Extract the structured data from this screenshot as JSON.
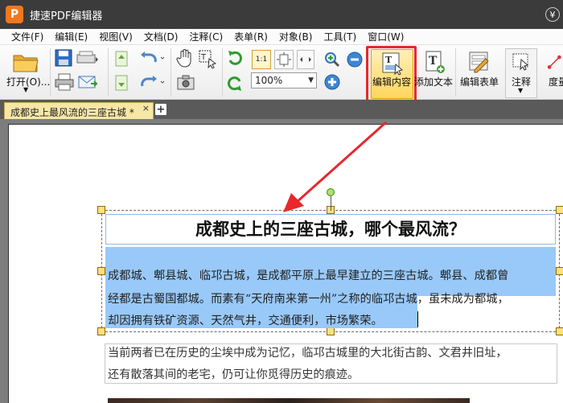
{
  "app": {
    "logo": "P",
    "title": "捷速PDF编辑器",
    "yen": "¥"
  },
  "menu": [
    "文件(F)",
    "编辑(E)",
    "视图(V)",
    "文档(D)",
    "注释(C)",
    "表单(R)",
    "对象(B)",
    "工具(T)",
    "窗口(W)"
  ],
  "toolbar": {
    "open_label": "打开(O)...",
    "zoom_value": "100%",
    "actual_size_label": "1:1",
    "edit_content_label": "编辑内容",
    "add_text_label": "添加文本",
    "edit_form_label": "编辑表单",
    "annotate_label": "注释",
    "degree_label": "度量"
  },
  "tabs": [
    {
      "label": "成都史上最风流的三座古城 *",
      "close": "×"
    }
  ],
  "tab_add": "+",
  "document": {
    "heading": "成都史上的三座古城，哪个最风流？",
    "para1_lines": [
      "成都城、郫县城、临邛古城，是成都平原上最早建立的三座古城。郫县、成都曾",
      "经都是古蜀国都城。而素有“天府南来第一州”之称的临邛古城，虽未成为都城，",
      "却因拥有铁矿资源、天然气井，交通便利，市场繁荣。"
    ],
    "para2_lines": [
      "当前两者已在历史的尘埃中成为记忆，临邛古城里的大北街古韵、文君井旧址，",
      "还有散落其间的老宅，仍可让你觅得历史的痕迹。"
    ]
  },
  "colors": {
    "titlebar": "#3b3b3b",
    "highlight": "#e8282b",
    "selection": "#99c9f8",
    "tab_active": "#f7e7a6"
  }
}
